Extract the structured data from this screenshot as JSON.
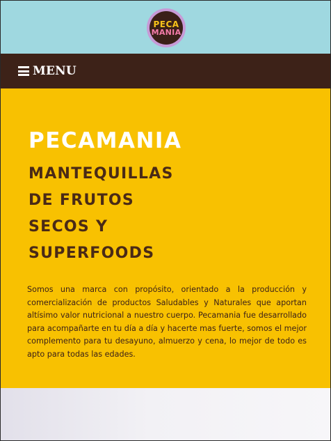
{
  "header": {
    "logo": {
      "line1": "PECA",
      "line2": "MANIA"
    }
  },
  "nav": {
    "menu_label": "MENU",
    "menu_icon": "hamburger-icon"
  },
  "hero": {
    "title": "PECAMANIA",
    "subtitle_lines": [
      "MANTEQUILLAS",
      "DE FRUTOS",
      "SECOS Y",
      "SUPERFOODS"
    ],
    "description": "Somos una marca con propósito, orientado a la producción y comercialización de productos Saludables y Naturales que aportan altísimo valor nutricional a nuestro cuerpo. Pecamania fue desarrollado para acompañarte en tu día a día y hacerte mas fuerte, somos el mejor complemento para tu desayuno, almuerzo y cena, lo mejor de todo es apto para todas las edades."
  },
  "colors": {
    "top_band": "#9fd8e0",
    "menu_bar": "#3d2218",
    "hero_background": "#f8c101",
    "hero_title": "#ffffff",
    "hero_subtitle": "#4a2a16"
  }
}
